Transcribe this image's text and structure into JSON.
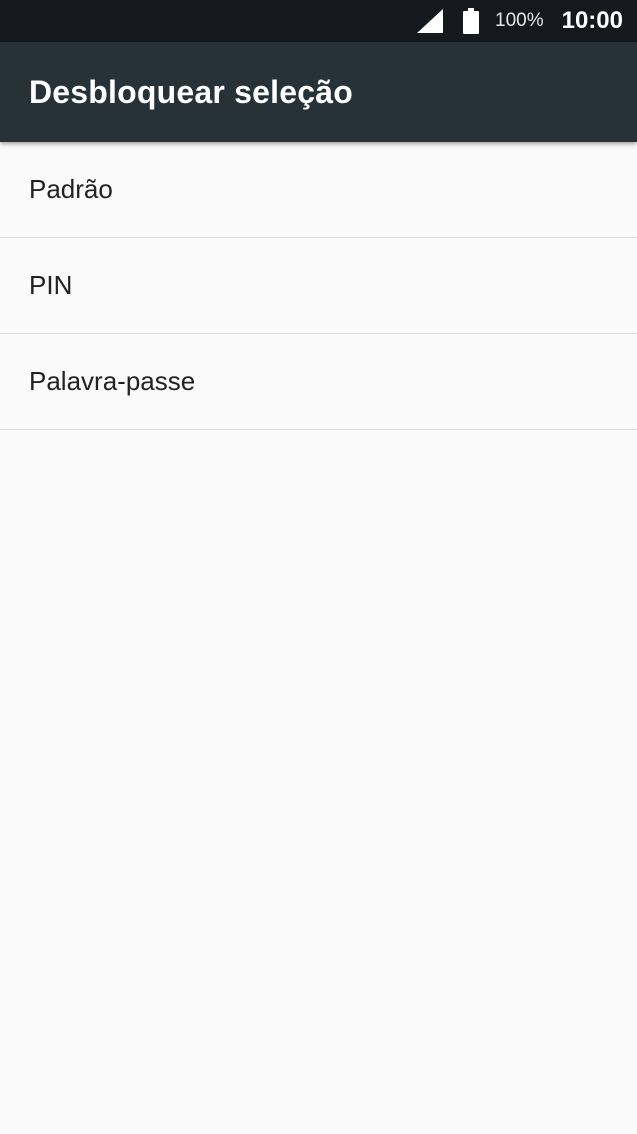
{
  "status_bar": {
    "signal_icon": "cell-signal-full-icon",
    "battery_icon": "battery-full-icon",
    "battery_percent": "100%",
    "time": "10:00"
  },
  "app_bar": {
    "title": "Desbloquear seleção"
  },
  "options": [
    {
      "label": "Padrão"
    },
    {
      "label": "PIN"
    },
    {
      "label": "Palavra-passe"
    }
  ],
  "colors": {
    "status_bar": "#15191d",
    "app_bar": "#263238",
    "background": "#fafafa",
    "divider": "#d9d9d9",
    "text_primary": "#222222"
  }
}
